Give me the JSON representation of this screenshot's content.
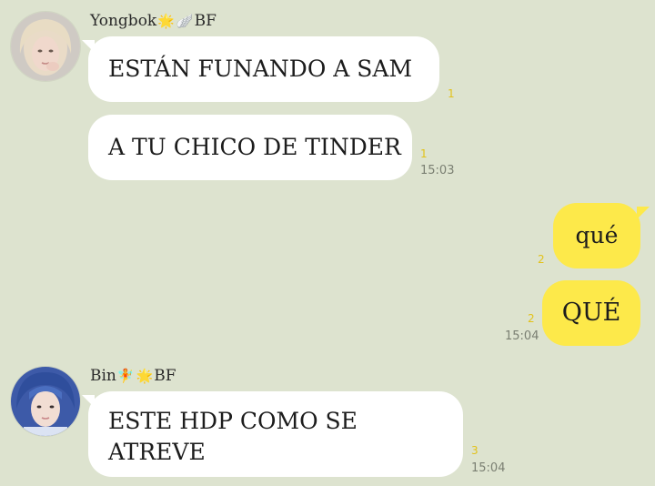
{
  "colors": {
    "background": "#dde3cf",
    "incoming_bubble": "#ffffff",
    "outgoing_bubble": "#fde94a",
    "read_count": "#e2c21a",
    "timestamp": "#7a7f72"
  },
  "groups": [
    {
      "sender": {
        "name": "Yongbok",
        "emoji1": "🌟",
        "emoji2": "🪽",
        "suffix": "BF"
      },
      "avatar_icon": "blonde-person-avatar",
      "messages": [
        {
          "text": "ESTÁN FUNANDO A SAM",
          "read": "1",
          "time": ""
        },
        {
          "text": "A TU CHICO DE TINDER",
          "read": "1",
          "time": "15:03"
        }
      ]
    },
    {
      "sender": {
        "name": "",
        "suffix": ""
      },
      "messages": [
        {
          "text": "qué",
          "read": "2",
          "time": ""
        },
        {
          "text": "QUÉ",
          "read": "2",
          "time": "15:04"
        }
      ]
    },
    {
      "sender": {
        "name": "Bin",
        "emoji1": "🧚",
        "emoji2": "🌟",
        "suffix": "BF"
      },
      "avatar_icon": "blue-hair-person-avatar",
      "messages": [
        {
          "text_line1": "ESTE HDP COMO SE",
          "text_line2": "ATREVE",
          "read": "3",
          "time": "15:04"
        }
      ]
    }
  ]
}
